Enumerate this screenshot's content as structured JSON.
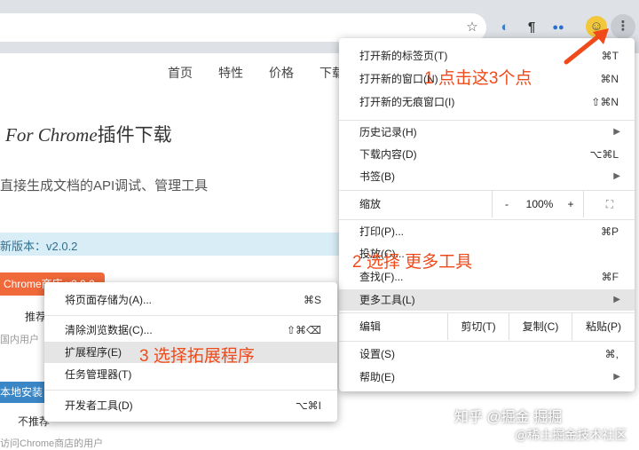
{
  "toolbar": {
    "icons": [
      "star-icon",
      "extension-icon",
      "pilcrow-extension-icon",
      "dots-extension-icon",
      "profile-avatar",
      "kebab-menu-icon"
    ]
  },
  "page": {
    "nav": [
      "首页",
      "特性",
      "价格",
      "下载"
    ],
    "title_italic": "For Chrome",
    "title_rest": "插件下载",
    "subtitle": "直接生成文档的API调试、管理工具",
    "banner": "新版本：v2.0.2",
    "store_button": "Chrome商店 v2.0.2",
    "recommend": "推荐",
    "domestic_note": "国内用户",
    "local_button": "本地安装",
    "not_recommend": "不推荐",
    "footer_note": "访问Chrome商店的用户"
  },
  "main_menu": {
    "new_tab": {
      "label": "打开新的标签页(T)",
      "shortcut": "⌘T"
    },
    "new_window": {
      "label": "打开新的窗口(N)",
      "shortcut": "⌘N"
    },
    "incognito": {
      "label": "打开新的无痕窗口(I)",
      "shortcut": "⇧⌘N"
    },
    "history": {
      "label": "历史记录(H)"
    },
    "downloads": {
      "label": "下载内容(D)",
      "shortcut": "⌥⌘L"
    },
    "bookmarks": {
      "label": "书签(B)"
    },
    "zoom": {
      "label": "缩放",
      "minus": "-",
      "value": "100%",
      "plus": "+"
    },
    "print": {
      "label": "打印(P)...",
      "shortcut": "⌘P"
    },
    "cast": {
      "label": "投放(C)..."
    },
    "find": {
      "label": "查找(F)...",
      "shortcut": "⌘F"
    },
    "more_tools": {
      "label": "更多工具(L)"
    },
    "edit": {
      "label": "编辑",
      "cut": "剪切(T)",
      "copy": "复制(C)",
      "paste": "粘贴(P)"
    },
    "settings": {
      "label": "设置(S)",
      "shortcut": "⌘,"
    },
    "help": {
      "label": "帮助(E)"
    }
  },
  "sub_menu": {
    "save_page": {
      "label": "将页面存储为(A)...",
      "shortcut": "⌘S"
    },
    "clear_data": {
      "label": "清除浏览数据(C)...",
      "shortcut": "⇧⌘⌫"
    },
    "extensions": {
      "label": "扩展程序(E)"
    },
    "task_manager": {
      "label": "任务管理器(T)"
    },
    "dev_tools": {
      "label": "开发者工具(D)",
      "shortcut": "⌥⌘I"
    }
  },
  "annotations": {
    "step1": "1 点击这3个点",
    "step2": "2 选择 更多工具",
    "step3": "3 选择拓展程序"
  },
  "watermark": {
    "line1": "知乎 @掘金 掘掘",
    "line2": "@稀土掘金技术社区"
  },
  "colors": {
    "accent": "#f04a1a",
    "banner_bg": "#d9edf7",
    "store_button": "#f0693a",
    "local_button": "#3a86c6"
  }
}
